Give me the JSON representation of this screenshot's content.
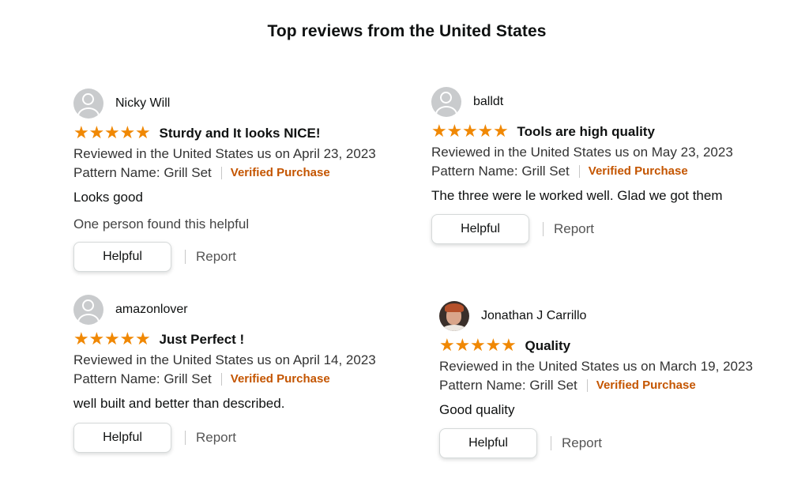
{
  "heading": "Top reviews from the United States",
  "colors": {
    "star": "#f08804",
    "verified": "#c45500"
  },
  "reviews": [
    {
      "reviewer": "Nicky Will",
      "avatar": "default-avatar-icon",
      "rating": 5,
      "stars": "★★★★★",
      "title": "Sturdy and It looks NICE!",
      "date_line": "Reviewed in the United States us on April 23, 2023",
      "pattern": "Pattern Name: Grill Set",
      "verified": "Verified Purchase",
      "body": "Looks good",
      "helpful_count": "One person found this helpful",
      "helpful_label": "Helpful",
      "report_label": "Report"
    },
    {
      "reviewer": "balldt",
      "avatar": "default-avatar-icon",
      "rating": 5,
      "stars": "★★★★★",
      "title": "Tools are high quality",
      "date_line": "Reviewed in the United States us on May 23, 2023",
      "pattern": "Pattern Name: Grill Set",
      "verified": "Verified Purchase",
      "body": "The three were le worked well. Glad we got them",
      "helpful_label": "Helpful",
      "report_label": "Report"
    },
    {
      "reviewer": "amazonlover",
      "avatar": "default-avatar-icon",
      "rating": 5,
      "stars": "★★★★★",
      "title": "Just Perfect !",
      "date_line": "Reviewed in the United States us on April 14, 2023",
      "pattern": "Pattern Name: Grill Set",
      "verified": "Verified Purchase",
      "body": "well built and better than described.",
      "helpful_label": "Helpful",
      "report_label": "Report"
    },
    {
      "reviewer": "Jonathan J Carrillo",
      "avatar": "photo-avatar",
      "rating": 5,
      "stars": "★★★★★",
      "title": "Quality",
      "date_line": "Reviewed in the United States us on March 19, 2023",
      "pattern": "Pattern Name: Grill Set",
      "verified": "Verified Purchase",
      "body": "Good quality",
      "helpful_label": "Helpful",
      "report_label": "Report"
    }
  ]
}
